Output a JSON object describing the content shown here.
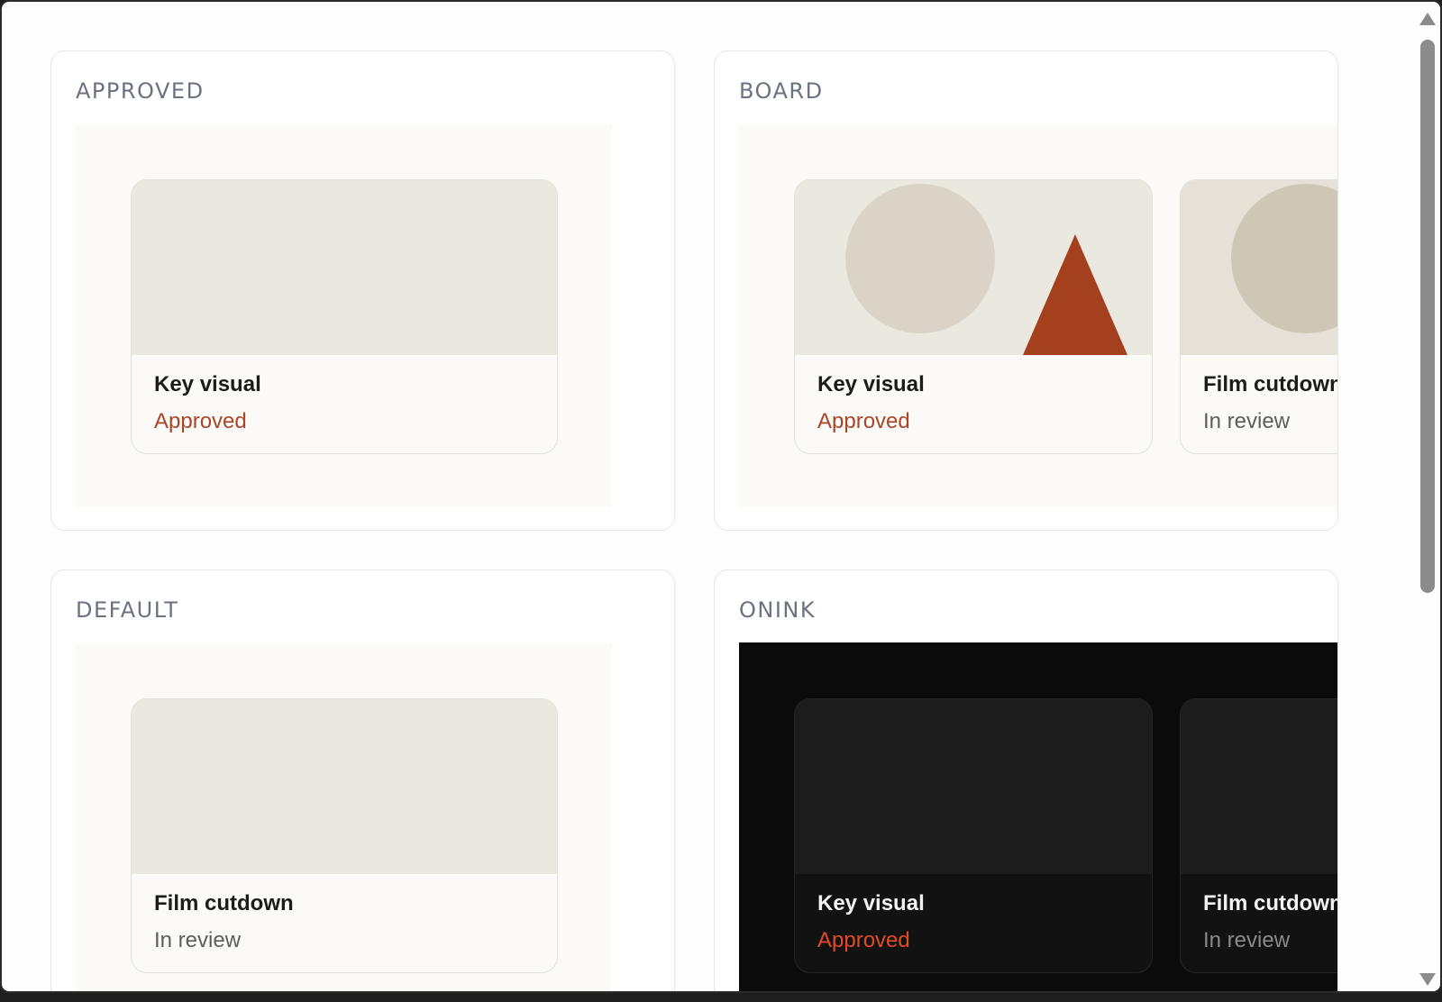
{
  "colors": {
    "accent_approved": "#a8462a",
    "accent_approved_dark": "#e04a26",
    "triangle": "#a5401f",
    "stage_light": "#fbfaf6",
    "stage_dark": "#0b0b0b"
  },
  "panels": [
    {
      "label": "APPROVED",
      "cards": [
        {
          "title": "Key visual",
          "status": "Approved"
        }
      ]
    },
    {
      "label": "BOARD",
      "cards": [
        {
          "title": "Key visual",
          "status": "Approved"
        },
        {
          "title": "Film cutdown",
          "status": "In review"
        }
      ]
    },
    {
      "label": "DEFAULT",
      "cards": [
        {
          "title": "Film cutdown",
          "status": "In review"
        }
      ]
    },
    {
      "label": "ONINK",
      "cards": [
        {
          "title": "Key visual",
          "status": "Approved"
        },
        {
          "title": "Film cutdown",
          "status": "In review"
        }
      ]
    }
  ],
  "icons": {
    "scroll_up": "scroll-up-arrow-icon",
    "scroll_down": "scroll-down-arrow-icon"
  }
}
